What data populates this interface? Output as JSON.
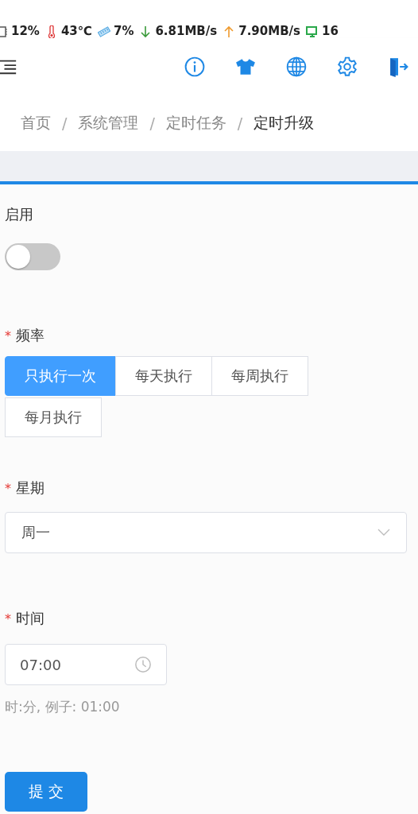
{
  "status_stats": [
    {
      "kind": "cpu",
      "text": "12%"
    },
    {
      "kind": "temperature",
      "text": "43℃"
    },
    {
      "kind": "memory",
      "text": "7%"
    },
    {
      "kind": "download",
      "text": "6.81MB/s"
    },
    {
      "kind": "upload",
      "text": "7.90MB/s"
    },
    {
      "kind": "clients",
      "text": "16"
    }
  ],
  "breadcrumb": [
    {
      "text": "首页",
      "current": false
    },
    {
      "text": "系统管理",
      "current": false
    },
    {
      "text": "定时任务",
      "current": false
    },
    {
      "text": "定时升级",
      "current": true
    }
  ],
  "breadcrumb_separator": "/",
  "enable": {
    "label": "启用",
    "required": false,
    "on": false
  },
  "frequency": {
    "label": "频率",
    "required": true,
    "options": [
      {
        "text": "只执行一次",
        "selected": true
      },
      {
        "text": "每天执行",
        "selected": false
      },
      {
        "text": "每周执行",
        "selected": false
      },
      {
        "text": "每月执行",
        "selected": false
      }
    ]
  },
  "weekday": {
    "label": "星期",
    "required": true,
    "value": "周一"
  },
  "time": {
    "label": "时间",
    "required": true,
    "value": "07:00",
    "hint": "时:分, 例子: 01:00"
  },
  "required_mark": "*",
  "submit": "提 交"
}
